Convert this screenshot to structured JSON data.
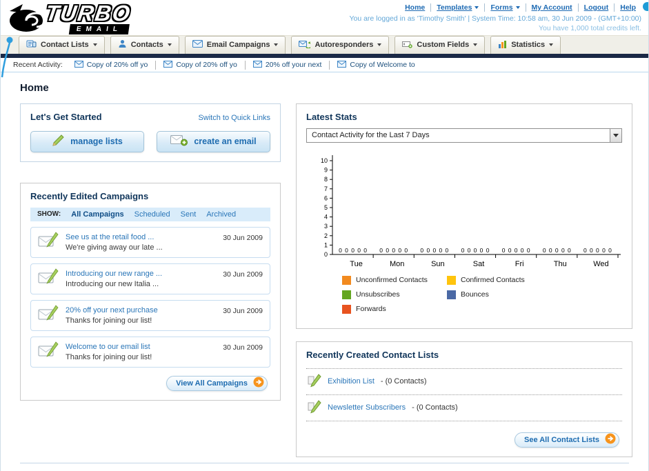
{
  "header": {
    "logo": {
      "line1": "TURBO",
      "line2": "EMAIL"
    },
    "nav": [
      "Home",
      "Templates",
      "Forms",
      "My Account",
      "Logout",
      "Help"
    ],
    "login_info": "You are logged in as 'Timothy Smith' | System Time: 10:58 am, 30 Jun 2009 - (GMT+10:00)",
    "credits": "You have 1,000 total credits left."
  },
  "tabs": [
    {
      "label": "Contact Lists"
    },
    {
      "label": "Contacts"
    },
    {
      "label": "Email Campaigns"
    },
    {
      "label": "Autoresponders"
    },
    {
      "label": "Custom Fields"
    },
    {
      "label": "Statistics"
    }
  ],
  "recent_activity": {
    "label": "Recent Activity:",
    "items": [
      "Copy of 20% off yo",
      "Copy of 20% off yo",
      "20% off your next",
      "Copy of Welcome to"
    ]
  },
  "page_title": "Home",
  "get_started": {
    "title": "Let's Get Started",
    "switch_link": "Switch to Quick Links",
    "manage_lists": "manage lists",
    "create_email": "create an email"
  },
  "campaigns": {
    "title": "Recently Edited Campaigns",
    "show_label": "SHOW:",
    "filters": [
      "All Campaigns",
      "Scheduled",
      "Sent",
      "Archived"
    ],
    "items": [
      {
        "title": "See us at the retail food ...",
        "subtitle": "We're giving away our late ...",
        "date": "30 Jun 2009"
      },
      {
        "title": "Introducing our new range ...",
        "subtitle": "Introducing our new Italia ...",
        "date": "30 Jun 2009"
      },
      {
        "title": "20% off your next purchase",
        "subtitle": "Thanks for joining our list!",
        "date": "30 Jun 2009"
      },
      {
        "title": "Welcome to our email list",
        "subtitle": "Thanks for joining our list!",
        "date": "30 Jun 2009"
      }
    ],
    "view_all": "View All Campaigns"
  },
  "stats": {
    "title": "Latest Stats",
    "dropdown_value": "Contact Activity for the Last 7 Days",
    "chart_data": {
      "type": "bar",
      "title": "Contact Activity for the Last 7 Days",
      "categories": [
        "Tue",
        "Mon",
        "Sun",
        "Sat",
        "Fri",
        "Thu",
        "Wed"
      ],
      "series": [
        {
          "name": "Unconfirmed Contacts",
          "color": "#f28a1f",
          "values": [
            0,
            0,
            0,
            0,
            0,
            0,
            0
          ]
        },
        {
          "name": "Confirmed Contacts",
          "color": "#ffc40d",
          "values": [
            0,
            0,
            0,
            0,
            0,
            0,
            0
          ]
        },
        {
          "name": "Unsubscribes",
          "color": "#64a621",
          "values": [
            0,
            0,
            0,
            0,
            0,
            0,
            0
          ]
        },
        {
          "name": "Bounces",
          "color": "#4a69a5",
          "values": [
            0,
            0,
            0,
            0,
            0,
            0,
            0
          ]
        },
        {
          "name": "Forwards",
          "color": "#e8531f",
          "values": [
            0,
            0,
            0,
            0,
            0,
            0,
            0
          ]
        }
      ],
      "ylim": [
        0,
        10
      ],
      "grid": false,
      "legend_position": "bottom",
      "data_labels": true
    }
  },
  "contact_lists": {
    "title": "Recently Created Contact Lists",
    "items": [
      {
        "name": "Exhibition List",
        "suffix": "- (0 Contacts)"
      },
      {
        "name": "Newsletter Subscribers",
        "suffix": "- (0 Contacts)"
      }
    ],
    "see_all": "See All Contact Lists"
  }
}
